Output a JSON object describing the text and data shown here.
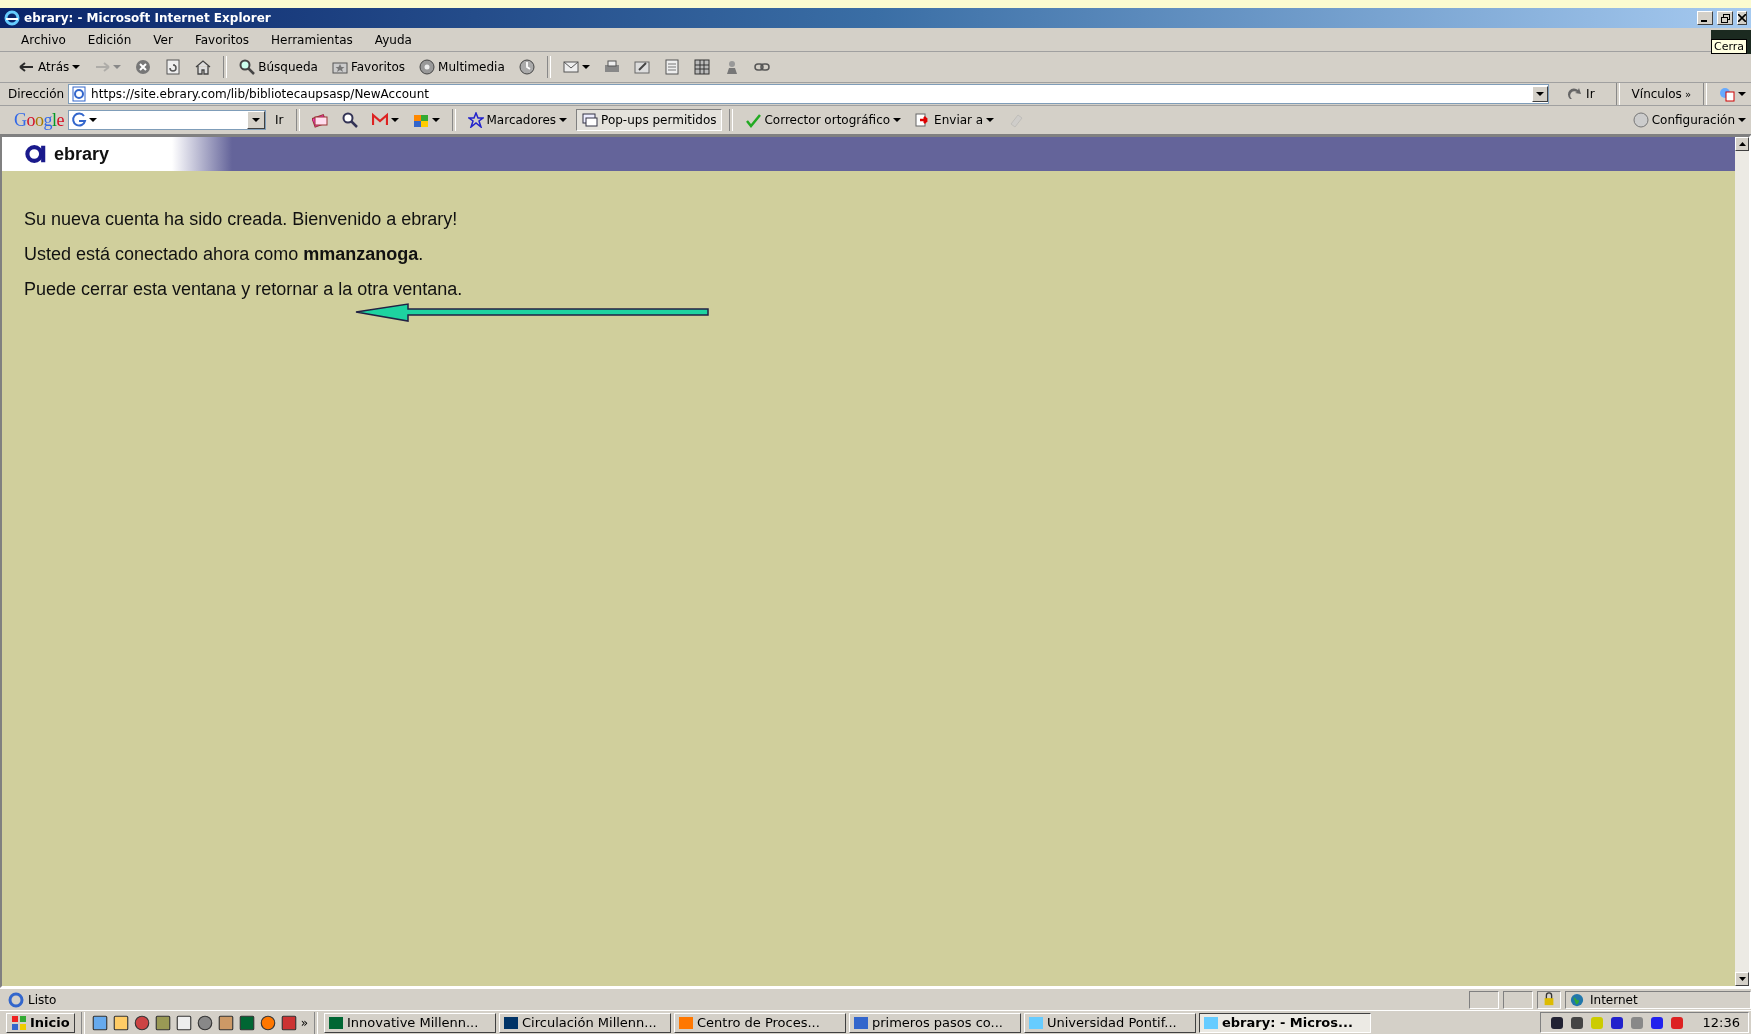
{
  "window": {
    "title": "ebrary: - Microsoft Internet Explorer"
  },
  "menu": [
    {
      "label": "Archivo"
    },
    {
      "label": "Edición"
    },
    {
      "label": "Ver"
    },
    {
      "label": "Favoritos"
    },
    {
      "label": "Herramientas"
    },
    {
      "label": "Ayuda"
    }
  ],
  "tooltip": {
    "text": "Cerra"
  },
  "toolbar": [
    {
      "kind": "labeled",
      "label": "Atrás",
      "dropdown": true,
      "disabled": false
    },
    {
      "kind": "icon",
      "dropdown": true,
      "disabled": true
    },
    {
      "kind": "icon",
      "dropdown": false,
      "disabled": false
    },
    {
      "kind": "icon",
      "dropdown": false,
      "disabled": false
    },
    {
      "kind": "icon",
      "dropdown": false,
      "disabled": false
    },
    {
      "kind": "separator"
    },
    {
      "kind": "labeled",
      "label": "Búsqueda",
      "dropdown": false,
      "disabled": false
    },
    {
      "kind": "labeled",
      "label": "Favoritos",
      "dropdown": false,
      "disabled": false
    },
    {
      "kind": "labeled",
      "label": "Multimedia",
      "dropdown": false,
      "disabled": false
    },
    {
      "kind": "icon",
      "dropdown": false,
      "disabled": false
    },
    {
      "kind": "separator"
    },
    {
      "kind": "icon",
      "dropdown": true,
      "disabled": false
    },
    {
      "kind": "icon",
      "dropdown": false,
      "disabled": false
    },
    {
      "kind": "icon",
      "dropdown": false,
      "disabled": false
    },
    {
      "kind": "icon",
      "dropdown": false,
      "disabled": false
    },
    {
      "kind": "icon",
      "dropdown": false,
      "disabled": false
    },
    {
      "kind": "icon",
      "dropdown": false,
      "disabled": false
    },
    {
      "kind": "icon",
      "dropdown": false,
      "disabled": false
    }
  ],
  "address_bar": {
    "label": "Dirección",
    "url": "https://site.ebrary.com/lib/bibliotecaupsasp/NewAccount",
    "go": "Ir",
    "links": "Vínculos",
    "more": "»"
  },
  "google_toolbar": {
    "logo": "Google",
    "go": "Ir",
    "items": [
      {
        "kind": "icon",
        "dropdown": false,
        "disabled": false,
        "pressed": false
      },
      {
        "kind": "icon",
        "dropdown": false,
        "disabled": false,
        "pressed": false
      },
      {
        "kind": "icon",
        "dropdown": true,
        "disabled": false,
        "pressed": false
      },
      {
        "kind": "icon",
        "dropdown": true,
        "disabled": false,
        "pressed": false
      },
      {
        "kind": "separator"
      },
      {
        "kind": "labeled",
        "label": "Marcadores",
        "dropdown": true,
        "disabled": false,
        "pressed": false
      },
      {
        "kind": "labeled",
        "label": "Pop-ups permitidos",
        "dropdown": false,
        "disabled": false,
        "pressed": true
      },
      {
        "kind": "separator"
      },
      {
        "kind": "labeled",
        "label": "Corrector ortográfico",
        "dropdown": true,
        "disabled": false,
        "pressed": false
      },
      {
        "kind": "labeled",
        "label": "Enviar a",
        "dropdown": true,
        "disabled": false,
        "pressed": false
      },
      {
        "kind": "icon",
        "dropdown": false,
        "disabled": true,
        "pressed": false
      }
    ],
    "settings": "Configuración"
  },
  "page": {
    "logo": "ebrary",
    "paragraphs": [
      "Su nueva cuenta ha sido creada. Bienvenido a ebrary!",
      "Usted está conectado ahora como **mmanzanoga**.",
      "Puede cerrar esta ventana y retornar a la otra ventana."
    ]
  },
  "status_bar": {
    "text": "Listo",
    "zone": "Internet"
  },
  "taskbar": {
    "start": "Inicio",
    "more": "»",
    "tasks": [
      {
        "label": "Innovative Millenn...",
        "selected": false
      },
      {
        "label": "Circulación Millenn...",
        "selected": false
      },
      {
        "label": "Centro de Proces...",
        "selected": false
      },
      {
        "label": "primeros pasos co...",
        "selected": false
      },
      {
        "label": "Universidad Pontif...",
        "selected": false
      },
      {
        "label": "ebrary: - Micros...",
        "selected": true
      }
    ],
    "clock": "12:36"
  }
}
